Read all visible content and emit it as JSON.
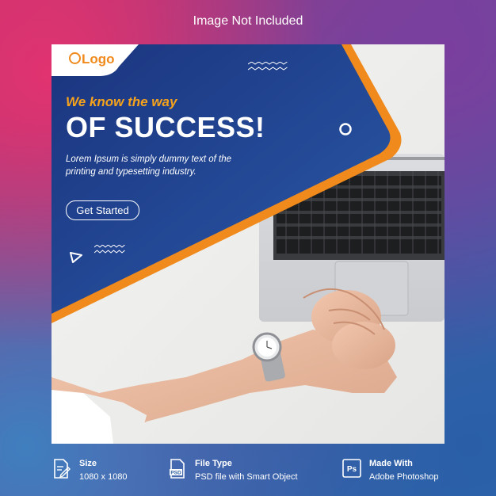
{
  "header": {
    "title": "Image Not Included"
  },
  "card": {
    "logo": "Logo",
    "kicker": "We know the way",
    "headline": "OF SUCCESS!",
    "body_line1": "Lorem Ipsum is simply dummy text of the",
    "body_line2": "printing and typesetting industry.",
    "cta_label": "Get Started",
    "colors": {
      "navy": "#1c3a8a",
      "blue": "#24509e",
      "orange": "#f08a1c"
    }
  },
  "footer": {
    "items": [
      {
        "label": "Size",
        "value": "1080 x 1080",
        "icon": "document-edit-icon"
      },
      {
        "label": "File Type",
        "value": "PSD file with Smart Object",
        "icon": "psd-file-icon"
      },
      {
        "label": "Made With",
        "value": "Adobe Photoshop",
        "icon": "photoshop-icon"
      }
    ]
  }
}
